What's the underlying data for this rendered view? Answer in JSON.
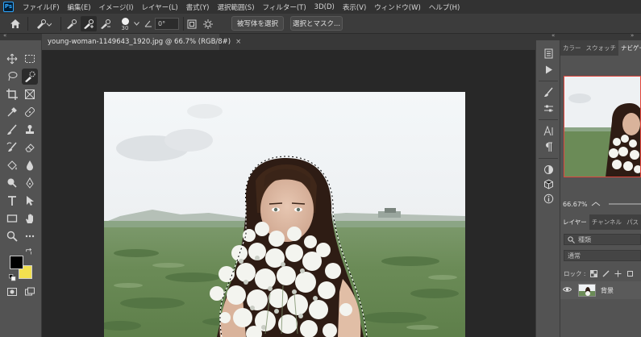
{
  "app": {
    "logo": "Ps"
  },
  "menu": [
    "ファイル(F)",
    "編集(E)",
    "イメージ(I)",
    "レイヤー(L)",
    "書式(Y)",
    "選択範囲(S)",
    "フィルター(T)",
    "3D(D)",
    "表示(V)",
    "ウィンドウ(W)",
    "ヘルプ(H)"
  ],
  "options": {
    "brush_size": "30",
    "angle_value": "0°",
    "select_subject_label": "被写体を選択",
    "select_mask_label": "選択とマスク..."
  },
  "document": {
    "tab_title": "young-woman-1149643_1920.jpg @ 66.7% (RGB/8#)",
    "close_glyph": "×"
  },
  "colors": {
    "foreground": "#000000",
    "background": "#f2e14f",
    "accent": "#31a8ff",
    "nav_frame": "#e0473d"
  },
  "panels": {
    "top_tabs": [
      "カラー",
      "スウォッチ",
      "ナビゲーター"
    ],
    "zoom": "66.67%",
    "layer_tabs": [
      "レイヤー",
      "チャンネル",
      "パス"
    ],
    "search_placeholder": "種類",
    "blend_mode": "通常",
    "lock_label": "ロック :",
    "layer_name": "背景"
  }
}
